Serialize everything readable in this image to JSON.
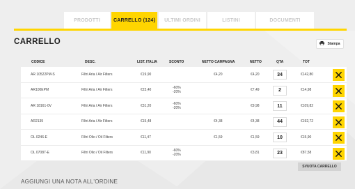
{
  "tabs": [
    {
      "label": "PRODOTTI",
      "active": false
    },
    {
      "label": "CARRELLO (124)",
      "active": true
    },
    {
      "label": "ULTIMI ORDINI",
      "active": false
    },
    {
      "label": "LISTINI",
      "active": false
    },
    {
      "label": "DOCUMENTI",
      "active": false
    }
  ],
  "page_title": "CARRELLO",
  "print_label": "Stampa",
  "columns": {
    "code": "CODICE",
    "desc": "DESC.",
    "list_price": "LIST. ITALIA",
    "discount": "SCONTO",
    "net_campaign": "NETTO CAMPAGNA",
    "net": "NETTO",
    "qty": "QTA",
    "tot": "TOT"
  },
  "rows": [
    {
      "code": "AR 10522PM-S",
      "desc": "Filtri Aria / Air Filters",
      "list_price": "€19,90",
      "discount_1": "",
      "discount_2": "",
      "net_campaign": "€4,20",
      "net": "€4,20",
      "qty": "34",
      "tot": "€142,80"
    },
    {
      "code": "AR100EPM",
      "desc": "Filtri Aria / Air Filters",
      "list_price": "€23,40",
      "discount_1": "-60%",
      "discount_2": "-20%",
      "net_campaign": "",
      "net": "€7,49",
      "qty": "2",
      "tot": "€14,98"
    },
    {
      "code": "AR 18161-0V",
      "desc": "Filtri Aria / Air Filters",
      "list_price": "€31,20",
      "discount_1": "-60%",
      "discount_2": "-20%",
      "net_campaign": "",
      "net": "€9,98",
      "qty": "11",
      "tot": "€109,82"
    },
    {
      "code": "AR2139",
      "desc": "Filtri Aria / Air Filters",
      "list_price": "€15,48",
      "discount_1": "",
      "discount_2": "",
      "net_campaign": "€4,38",
      "net": "€4,38",
      "qty": "44",
      "tot": "€192,72"
    },
    {
      "code": "OL 0246-E",
      "desc": "Filtri Olio / Oil Filters",
      "list_price": "€11,47",
      "discount_1": "",
      "discount_2": "",
      "net_campaign": "€1,59",
      "net": "€1,59",
      "qty": "10",
      "tot": "€15,90"
    },
    {
      "code": "OL 07087-E",
      "desc": "Filtri Olio / Oil Filters",
      "list_price": "€11,90",
      "discount_1": "-60%",
      "discount_2": "-20%",
      "net_campaign": "",
      "net": "€3,81",
      "qty": "23",
      "tot": "€87,58"
    }
  ],
  "empty_cart_label": "SVUOTA CARRELLO",
  "note_heading": "AGGIUNGI UNA NOTA ALL'ORDINE",
  "colors": {
    "accent": "#ffd500",
    "background": "#eeeeee"
  },
  "icons": {
    "print": "printer-icon",
    "delete": "close-icon"
  }
}
